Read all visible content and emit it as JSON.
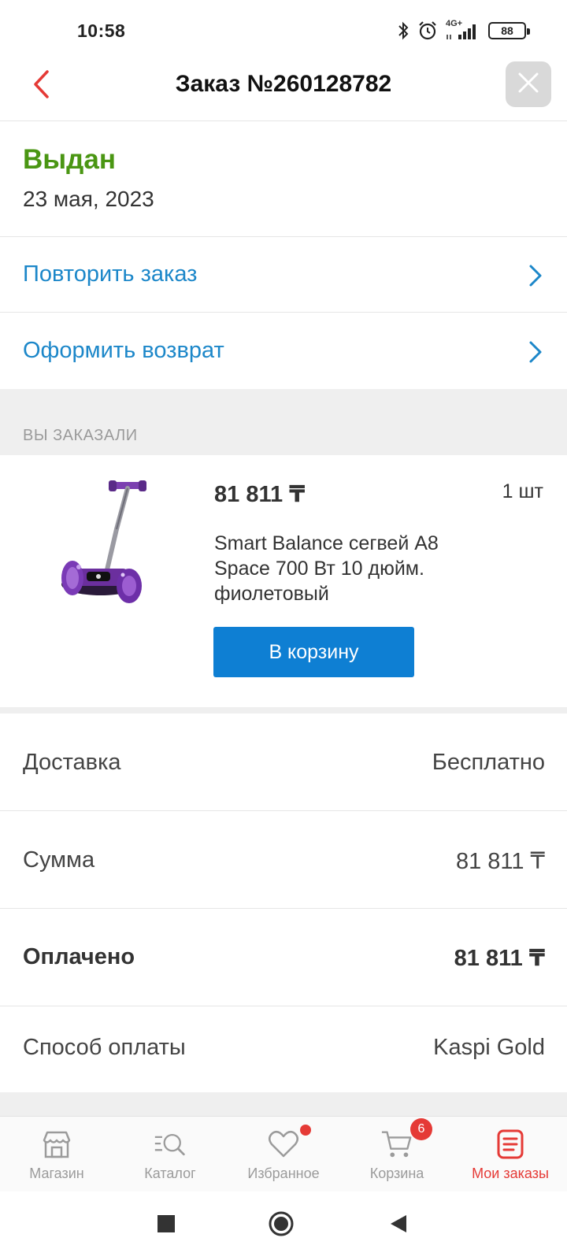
{
  "status_bar": {
    "time": "10:58",
    "network_label": "4G+",
    "battery": "88",
    "icons": [
      "bluetooth-icon",
      "alarm-icon",
      "signal-icon",
      "battery-icon"
    ]
  },
  "header": {
    "title": "Заказ №260128782",
    "back_icon": "chevron-left-icon",
    "close_icon": "close-icon"
  },
  "order": {
    "status": "Выдан",
    "date": "23 мая, 2023",
    "status_color": "#4a9613"
  },
  "actions": [
    {
      "label": "Повторить заказ"
    },
    {
      "label": "Оформить возврат"
    }
  ],
  "section_title": "ВЫ ЗАКАЗАЛИ",
  "product": {
    "price": "81 811 ₸",
    "quantity": "1 шт",
    "name": "Smart Balance сегвей А8 Space 700 Вт 10 дюйм. фиолетовый",
    "cart_button": "В корзину"
  },
  "summary": [
    {
      "key": "Доставка",
      "value": "Бесплатно",
      "bold": false
    },
    {
      "key": "Сумма",
      "value": "81 811 ₸",
      "bold": false
    },
    {
      "key": "Оплачено",
      "value": "81 811 ₸",
      "bold": true
    },
    {
      "key": "Способ оплаты",
      "value": "Kaspi Gold",
      "bold": false
    }
  ],
  "bottom_nav": [
    {
      "label": "Магазин",
      "icon": "store-icon",
      "active": false
    },
    {
      "label": "Каталог",
      "icon": "catalog-search-icon",
      "active": false
    },
    {
      "label": "Избранное",
      "icon": "heart-icon",
      "active": false,
      "dot": true
    },
    {
      "label": "Корзина",
      "icon": "cart-icon",
      "active": false,
      "badge": "6"
    },
    {
      "label": "Мои заказы",
      "icon": "orders-icon",
      "active": true
    }
  ],
  "colors": {
    "accent_red": "#e53a36",
    "link_blue": "#1c87c9",
    "button_blue": "#0e7fd3",
    "status_green": "#4a9613"
  }
}
